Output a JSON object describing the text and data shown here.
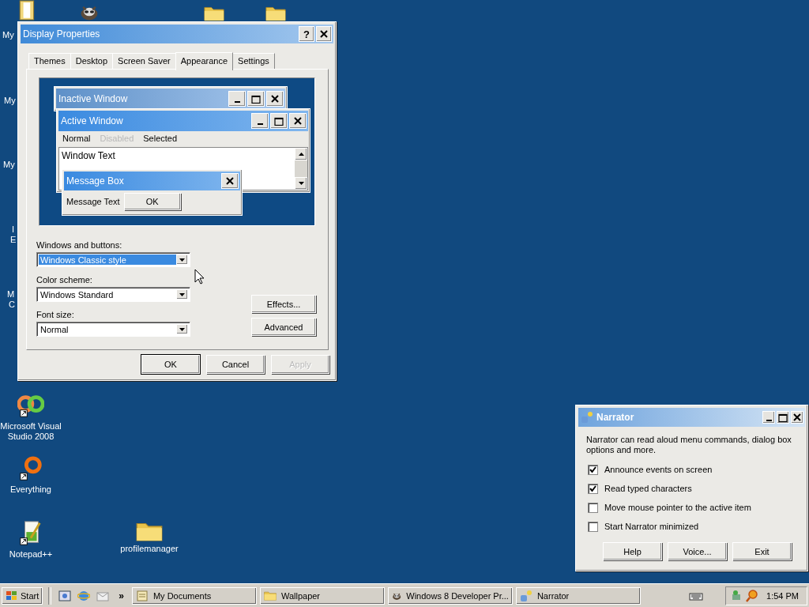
{
  "desktop": {
    "edge_labels": [
      "My",
      "My",
      "My",
      "I",
      "E",
      "M",
      "C"
    ],
    "top_icons": [
      {
        "kind": "document-folder"
      },
      {
        "kind": "raccoon"
      },
      {
        "kind": "folder"
      },
      {
        "kind": "folder"
      }
    ],
    "icons": [
      {
        "label": "Microsoft Visual Studio 2008",
        "kind": "infinity"
      },
      {
        "label": "Everything",
        "kind": "ring"
      },
      {
        "label": "Notepad++",
        "kind": "notepad"
      },
      {
        "label": "profilemanager",
        "kind": "folder"
      }
    ]
  },
  "dialog": {
    "title": "Display Properties",
    "help": "?",
    "tabs": [
      {
        "label": "Themes",
        "selected": false
      },
      {
        "label": "Desktop",
        "selected": false
      },
      {
        "label": "Screen Saver",
        "selected": false
      },
      {
        "label": "Appearance",
        "selected": true
      },
      {
        "label": "Settings",
        "selected": false
      }
    ],
    "preview": {
      "inactive_title": "Inactive Window",
      "active_title": "Active Window",
      "menu": [
        {
          "label": "Normal",
          "disabled": false
        },
        {
          "label": "Disabled",
          "disabled": true
        },
        {
          "label": "Selected",
          "disabled": false
        }
      ],
      "window_text": "Window Text",
      "message_title": "Message Box",
      "message_text": "Message Text",
      "message_button": "OK"
    },
    "fields": [
      {
        "label": "Windows and buttons:",
        "value": "Windows Classic style",
        "highlighted": true
      },
      {
        "label": "Color scheme:",
        "value": "Windows Standard",
        "highlighted": false
      },
      {
        "label": "Font size:",
        "value": "Normal",
        "highlighted": false
      }
    ],
    "side_buttons": [
      "Effects...",
      "Advanced"
    ],
    "buttons": [
      {
        "label": "OK",
        "default": true,
        "disabled": false
      },
      {
        "label": "Cancel",
        "default": false,
        "disabled": false
      },
      {
        "label": "Apply",
        "default": false,
        "disabled": true
      }
    ]
  },
  "narrator": {
    "title": "Narrator",
    "description": "Narrator can read aloud menu commands, dialog box options and more.",
    "options": [
      {
        "label": "Announce events on screen",
        "checked": true
      },
      {
        "label": "Read typed characters",
        "checked": true
      },
      {
        "label": "Move mouse pointer to the active item",
        "checked": false
      },
      {
        "label": "Start Narrator minimized",
        "checked": false
      }
    ],
    "buttons": [
      "Help",
      "Voice...",
      "Exit"
    ]
  },
  "taskbar": {
    "start": "Start",
    "chevron": "»",
    "tasks": [
      {
        "label": "My Documents",
        "kind": "document"
      },
      {
        "label": "Wallpaper",
        "kind": "folder"
      },
      {
        "label": "Windows 8 Developer Pr...",
        "kind": "raccoon"
      },
      {
        "label": "Narrator",
        "kind": "narrator"
      }
    ],
    "clock": "1:54 PM"
  }
}
